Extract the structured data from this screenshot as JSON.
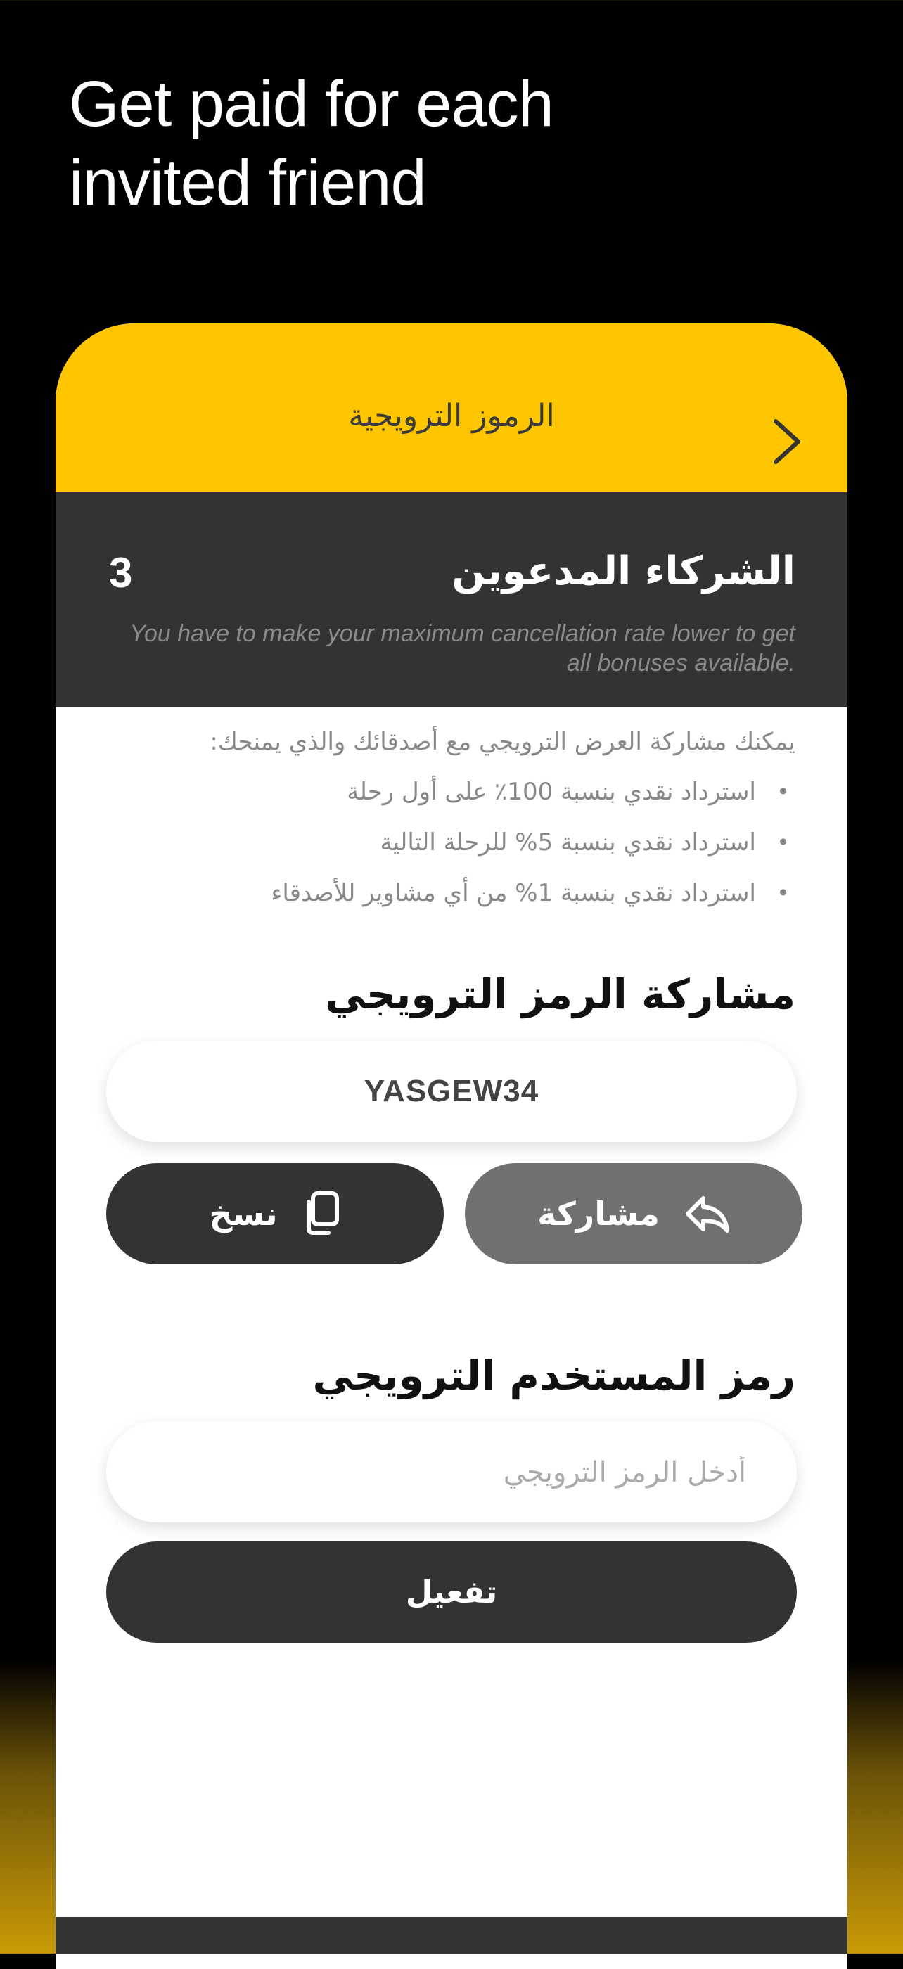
{
  "headline": {
    "line1": "Get paid for each",
    "line2": "invited friend"
  },
  "card": {
    "header_title": "الرموز الترويجية",
    "invited": {
      "title": "الشركاء المدعوين",
      "count": "3",
      "note": "You have to make your maximum cancellation rate lower to get all bonuses available."
    },
    "intro": "يمكنك مشاركة العرض الترويجي مع أصدقائك والذي يمنحك:",
    "benefits": [
      "استرداد نقدي بنسبة 100٪ على أول رحلة",
      "استرداد نقدي بنسبة 5% للرحلة التالية",
      "استرداد نقدي بنسبة 1% من أي مشاوير للأصدقاء"
    ],
    "share_section": {
      "title": "مشاركة الرمز الترويجي",
      "code": "YASGEW34",
      "share_label": "مشاركة",
      "copy_label": "نسخ"
    },
    "user_code_section": {
      "title": "رمز المستخدم الترويجي",
      "placeholder": "أدخل الرمز الترويجي",
      "value": "",
      "activate_label": "تفعيل"
    }
  },
  "colors": {
    "accent": "#fec601",
    "dark": "#333333",
    "share_button": "#707070"
  },
  "icons": {
    "back": "chevron-right-icon",
    "share": "share-arrow-icon",
    "copy": "copy-icon"
  }
}
